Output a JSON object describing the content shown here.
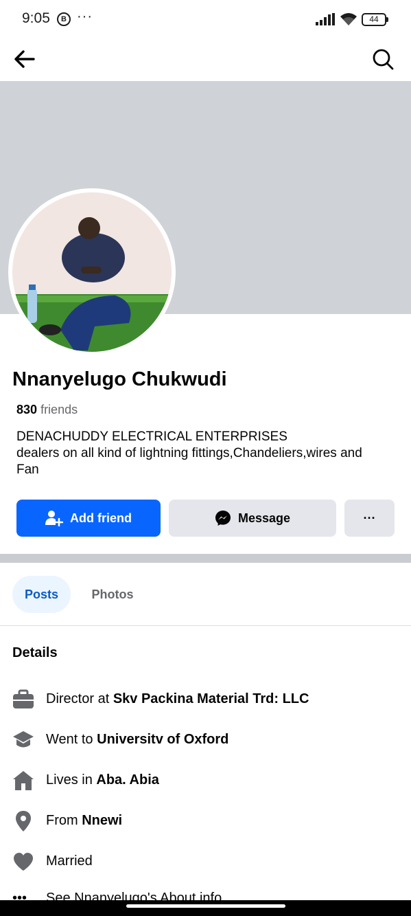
{
  "status_bar": {
    "time": "9:05",
    "b_icon": "B",
    "more": "···",
    "battery": "44"
  },
  "header": {
    "back_icon": "arrow-left-icon",
    "search_icon": "search-icon"
  },
  "profile": {
    "name": "Nnanyelugo Chukwudi",
    "friends_count": "830",
    "friends_label": "friends",
    "bio_lines": [
      "DENACHUDDY ELECTRICAL ENTERPRISES",
      "dealers on all kind of lightning fittings,Chandeliers,wires and",
      "Fan"
    ]
  },
  "actions": {
    "add_friend": "Add friend",
    "message": "Message",
    "more": "···"
  },
  "tabs": [
    {
      "label": "Posts",
      "active": true
    },
    {
      "label": "Photos",
      "active": false
    }
  ],
  "details": {
    "title": "Details",
    "items": [
      {
        "icon": "briefcase-icon",
        "prefix": "Director at ",
        "bold": "Skv Packina Material Trd: LLC"
      },
      {
        "icon": "graduation-cap-icon",
        "prefix": "Went to ",
        "bold": "Universitv of Oxford"
      },
      {
        "icon": "home-icon",
        "prefix": "Lives in ",
        "bold": "Aba. Abia"
      },
      {
        "icon": "location-pin-icon",
        "prefix": "From ",
        "bold": "Nnewi"
      },
      {
        "icon": "heart-icon",
        "prefix": "Married",
        "bold": ""
      }
    ],
    "about_link": "See Nnanyelugo's About info"
  },
  "colors": {
    "primary": "#0866ff",
    "secondary_button": "#e4e6eb",
    "cover": "#cfd2d6",
    "tab_active_bg": "#ebf5ff",
    "tab_active_text": "#0a5bc4",
    "muted_text": "#65676b"
  }
}
